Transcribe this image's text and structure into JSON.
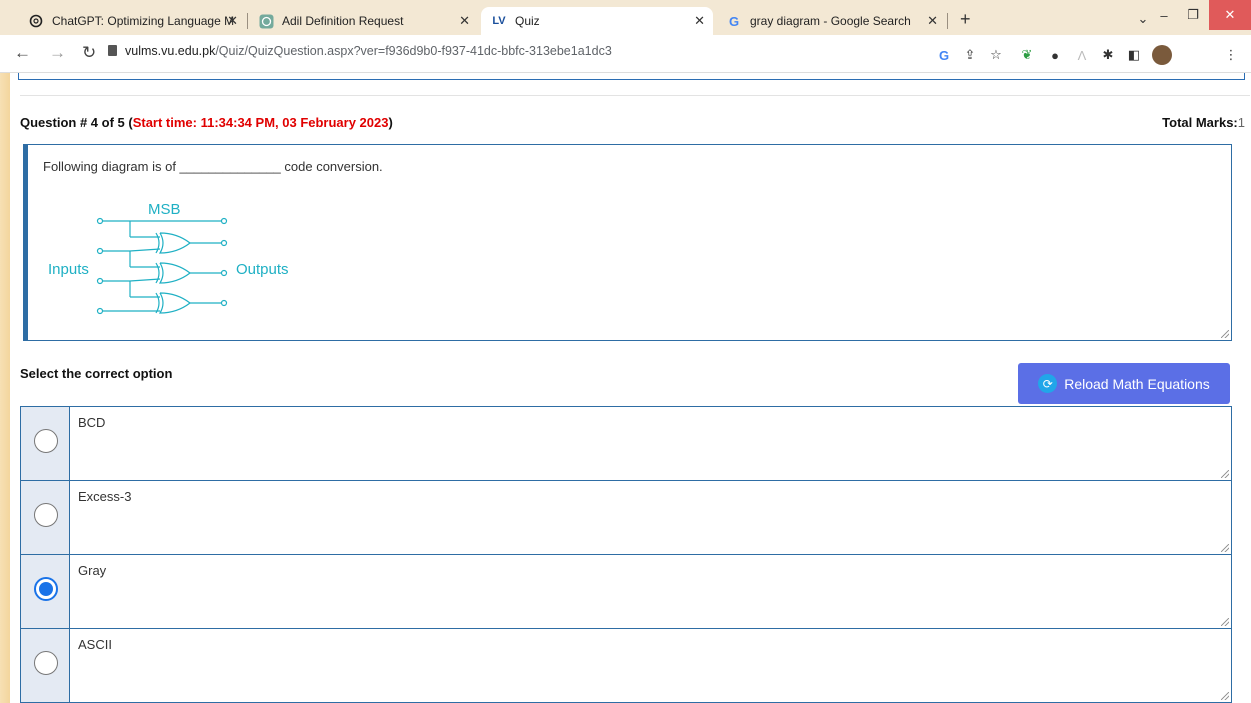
{
  "browser": {
    "tabs": [
      {
        "title": "ChatGPT: Optimizing Language M",
        "active": false
      },
      {
        "title": "Adil Definition Request",
        "active": false
      },
      {
        "title": "Quiz",
        "active": true
      },
      {
        "title": "gray diagram - Google Search",
        "active": false
      }
    ],
    "url_host": "vulms.vu.edu.pk",
    "url_path": "/Quiz/QuizQuestion.aspx?ver=f936d9b0-f937-41dc-bbfc-313ebe1a1dc3"
  },
  "question": {
    "number_label": "Question # 4 of 5 (",
    "start_time": "Start time: 11:34:34 PM, 03 February 2023",
    "close_paren": ")",
    "total_marks_label": "Total Marks:",
    "total_marks_value": "1",
    "text": "Following diagram is of ______________ code conversion.",
    "diagram": {
      "msb": "MSB",
      "inputs": "Inputs",
      "outputs": "Outputs"
    }
  },
  "select_label": "Select the correct option",
  "reload_label": "Reload Math Equations",
  "options": [
    {
      "label": "BCD",
      "selected": false
    },
    {
      "label": "Excess-3",
      "selected": false
    },
    {
      "label": "Gray",
      "selected": true
    },
    {
      "label": "ASCII",
      "selected": false
    }
  ]
}
